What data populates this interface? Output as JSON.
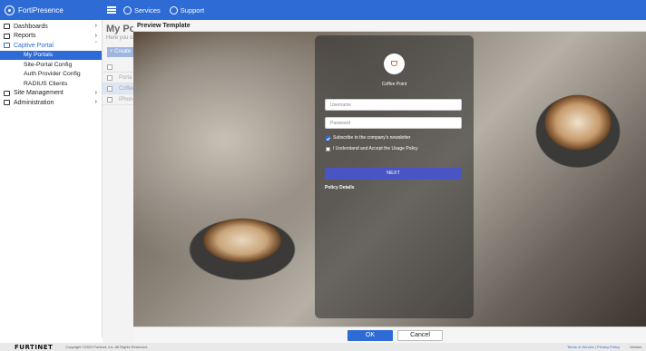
{
  "app": {
    "title": "FortiPresence"
  },
  "topnav": {
    "services": "Services",
    "support": "Support"
  },
  "sidebar": {
    "items": [
      {
        "label": "Dashboards"
      },
      {
        "label": "Reports"
      },
      {
        "label": "Captive Portal"
      },
      {
        "label": "Site Management"
      },
      {
        "label": "Administration"
      }
    ],
    "captive_portal_sub": [
      {
        "label": "My Portals"
      },
      {
        "label": "Site-Portal Config"
      },
      {
        "label": "Auth Provider Config"
      },
      {
        "label": "RADIUS Clients"
      }
    ]
  },
  "background_page": {
    "title": "My Portals",
    "subtitle": "Here you can",
    "create_label": "+ Create",
    "rows": [
      "Porta",
      "Coffee",
      "iPhone"
    ]
  },
  "modal": {
    "title": "Preview Template",
    "ok_label": "OK",
    "cancel_label": "Cancel"
  },
  "login_card": {
    "brand_name": "Coffee Point",
    "username_placeholder": "Username",
    "password_placeholder": "Password",
    "newsletter_label": "Subscribe to the company's newsletter",
    "newsletter_checked": true,
    "policy_label": "I Understand and Accept the Usage Policy",
    "policy_checked": false,
    "next_label": "NEXT",
    "policy_details": "Policy Details"
  },
  "footer": {
    "brand": "FURTINET",
    "copyright": "Copyright ©2023 Fortinet, Inc. All Rights Reserved.",
    "links": "Terms of Service | Privacy Policy",
    "version": "Version"
  },
  "colors": {
    "accent": "#2f6bd5",
    "next_button": "#4a55c5"
  }
}
